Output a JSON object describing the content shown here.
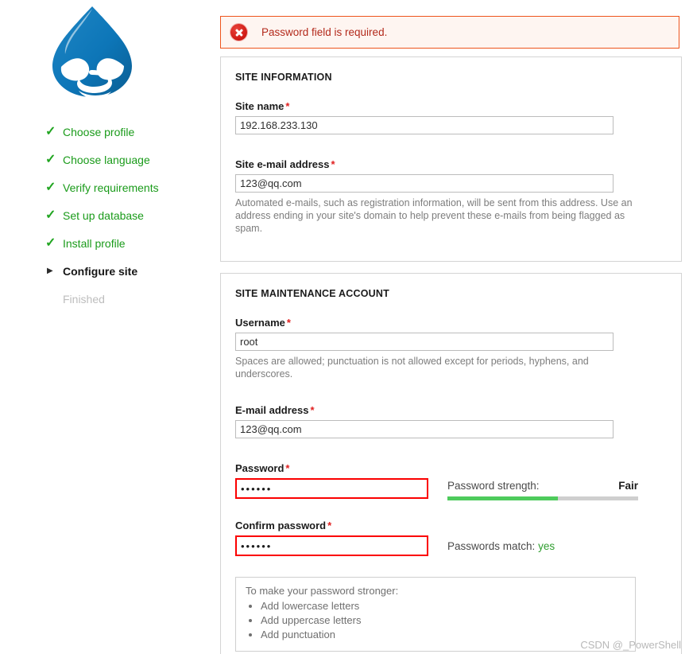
{
  "sidebar": {
    "logo_alt": "drupal-logo",
    "tasks": [
      {
        "label": "Choose profile",
        "state": "done"
      },
      {
        "label": "Choose language",
        "state": "done"
      },
      {
        "label": "Verify requirements",
        "state": "done"
      },
      {
        "label": "Set up database",
        "state": "done"
      },
      {
        "label": "Install profile",
        "state": "done"
      },
      {
        "label": "Configure site",
        "state": "active"
      },
      {
        "label": "Finished",
        "state": "todo"
      }
    ],
    "check_glyph": "✓",
    "marker_glyph": "▶"
  },
  "error": {
    "message": "Password field is required.",
    "icon": "error-circle-x-icon",
    "border_color": "#ed541d",
    "background_color": "#fef5f1",
    "text_color": "#b3291b"
  },
  "site_information": {
    "title": "SITE INFORMATION",
    "site_name": {
      "label": "Site name",
      "required_marker": "*",
      "value": "192.168.233.130"
    },
    "site_email": {
      "label": "Site e-mail address",
      "required_marker": "*",
      "value": "123@qq.com",
      "help": "Automated e-mails, such as registration information, will be sent from this address. Use an address ending in your site's domain to help prevent these e-mails from being flagged as spam."
    }
  },
  "maintenance_account": {
    "title": "SITE MAINTENANCE ACCOUNT",
    "username": {
      "label": "Username",
      "required_marker": "*",
      "value": "root",
      "help": "Spaces are allowed; punctuation is not allowed except for periods, hyphens, and underscores."
    },
    "email": {
      "label": "E-mail address",
      "required_marker": "*",
      "value": "123@qq.com"
    },
    "password": {
      "label": "Password",
      "required_marker": "*",
      "value": "••••••",
      "error_border_color": "#fb0000"
    },
    "confirm_password": {
      "label": "Confirm password",
      "required_marker": "*",
      "value": "••••••",
      "error_border_color": "#fb0000"
    },
    "strength": {
      "label": "Password strength:",
      "value": "Fair",
      "percent": 58,
      "fill_color": "#4ecb5c",
      "track_color": "#cfcfcf"
    },
    "match": {
      "label": "Passwords match:",
      "value": "yes",
      "value_color": "#2f9e2f"
    },
    "tips": {
      "title": "To make your password stronger:",
      "items": [
        "Add lowercase letters",
        "Add uppercase letters",
        "Add punctuation"
      ]
    }
  },
  "watermark": {
    "text": "CSDN @_PowerShell"
  }
}
